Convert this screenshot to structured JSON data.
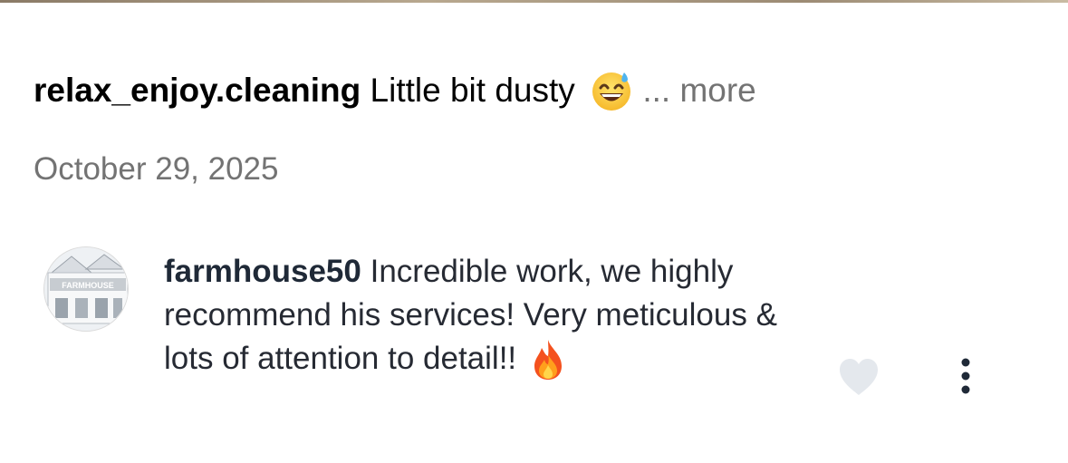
{
  "post": {
    "username": "relax_enjoy.cleaning",
    "caption_text": "Little bit dusty",
    "caption_emoji": "grinning-face-with-sweat",
    "more_label": "... more",
    "date": "October 29, 2025"
  },
  "comment": {
    "username": "farmhouse50",
    "text": "Incredible work, we highly recommend his services! Very meticulous & lots of attention to detail!!",
    "emoji": "fire",
    "avatar_icon": "storefront-avatar",
    "avatar_sign_text": "FARMHOUSE"
  },
  "icons": {
    "like": "heart-icon",
    "menu": "more-vertical-icon"
  },
  "colors": {
    "text_primary": "#000000",
    "text_secondary": "#737373",
    "like_icon": "#e4e8ed",
    "menu_icon": "#1f2937"
  }
}
